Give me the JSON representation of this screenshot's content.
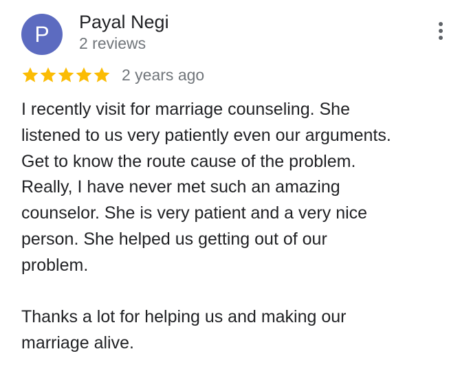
{
  "review": {
    "avatar_letter": "P",
    "avatar_color": "#5c6bc0",
    "reviewer_name": "Payal Negi",
    "review_count": "2 reviews",
    "rating": 5,
    "rating_max": 5,
    "star_color": "#fbbc04",
    "date": "2 years ago",
    "more_icon": "more-vert-icon",
    "paragraphs": [
      {
        "lines": [
          "I recently visit for marriage counseling. She",
          "listened to us very patiently even our arguments.",
          "Get to know the route cause of the problem.",
          "Really, I have never met such an amazing",
          "counselor. She is very patient and a very nice",
          "person. She helped us getting out of our",
          "problem."
        ]
      },
      {
        "lines": [
          "Thanks a lot for helping us and making our",
          "marriage alive."
        ]
      }
    ]
  }
}
